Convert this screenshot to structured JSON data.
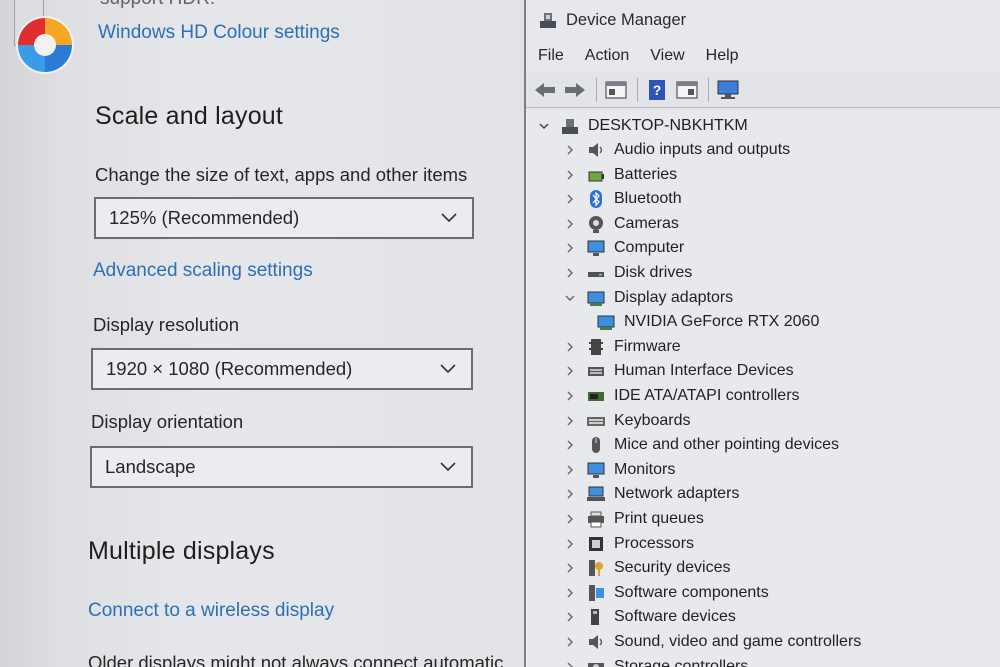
{
  "settings": {
    "top_partial_text": "support HDR.",
    "hd_colour_link": "Windows HD Colour settings",
    "scale_heading": "Scale and layout",
    "size_label": "Change the size of text, apps and other items",
    "scale_value": "125% (Recommended)",
    "advanced_scaling_link": "Advanced scaling settings",
    "resolution_label": "Display resolution",
    "resolution_value": "1920 × 1080 (Recommended)",
    "orientation_label": "Display orientation",
    "orientation_value": "Landscape",
    "multiple_heading": "Multiple displays",
    "wireless_link": "Connect to a wireless display",
    "bottom_partial_text": "Older displays might not always connect automatic"
  },
  "device_manager": {
    "title": "Device Manager",
    "menu": [
      "File",
      "Action",
      "View",
      "Help"
    ],
    "toolbar_icons": [
      "back-arrow-icon",
      "forward-arrow-icon",
      "properties-pane-icon",
      "help-icon",
      "action-pane-icon",
      "monitor-scan-icon"
    ],
    "root": "DESKTOP-NBKHTKM",
    "categories": [
      {
        "label": "Audio inputs and outputs",
        "icon": "speaker-icon"
      },
      {
        "label": "Batteries",
        "icon": "battery-icon"
      },
      {
        "label": "Bluetooth",
        "icon": "bluetooth-icon"
      },
      {
        "label": "Cameras",
        "icon": "camera-icon"
      },
      {
        "label": "Computer",
        "icon": "computer-icon"
      },
      {
        "label": "Disk drives",
        "icon": "disk-drive-icon"
      },
      {
        "label": "Display adaptors",
        "icon": "display-adapter-icon",
        "expanded": true
      },
      {
        "label": "Firmware",
        "icon": "firmware-icon"
      },
      {
        "label": "Human Interface Devices",
        "icon": "hid-icon"
      },
      {
        "label": "IDE ATA/ATAPI controllers",
        "icon": "ide-controller-icon"
      },
      {
        "label": "Keyboards",
        "icon": "keyboard-icon"
      },
      {
        "label": "Mice and other pointing devices",
        "icon": "mouse-icon"
      },
      {
        "label": "Monitors",
        "icon": "monitor-icon"
      },
      {
        "label": "Network adapters",
        "icon": "network-adapter-icon"
      },
      {
        "label": "Print queues",
        "icon": "printer-icon"
      },
      {
        "label": "Processors",
        "icon": "processor-icon"
      },
      {
        "label": "Security devices",
        "icon": "security-key-icon"
      },
      {
        "label": "Software components",
        "icon": "software-component-icon"
      },
      {
        "label": "Software devices",
        "icon": "software-device-icon"
      },
      {
        "label": "Sound, video and game controllers",
        "icon": "sound-controller-icon"
      },
      {
        "label": "Storage controllers",
        "icon": "storage-controller-icon"
      }
    ],
    "display_adaptor_child": "NVIDIA GeForce RTX 2060"
  }
}
